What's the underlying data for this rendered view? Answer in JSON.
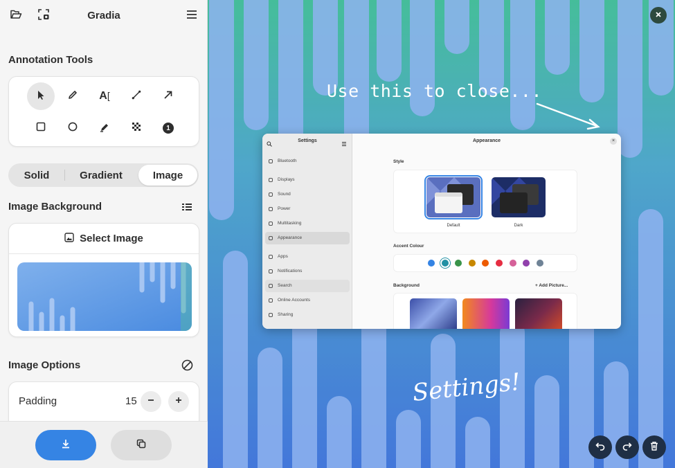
{
  "app": {
    "title": "Gradia"
  },
  "sidebar": {
    "annotation_tools_title": "Annotation Tools",
    "tools": [
      {
        "name": "select-icon"
      },
      {
        "name": "pencil-icon"
      },
      {
        "name": "text-icon"
      },
      {
        "name": "line-icon"
      },
      {
        "name": "arrow-icon"
      },
      {
        "name": "rectangle-icon"
      },
      {
        "name": "circle-icon"
      },
      {
        "name": "highlighter-icon"
      },
      {
        "name": "censor-icon"
      },
      {
        "name": "number-icon"
      }
    ],
    "number_tool_label": "1",
    "text_tool_label": "A",
    "background_modes": [
      "Solid",
      "Gradient",
      "Image"
    ],
    "active_background_mode": "Image",
    "image_background_title": "Image Background",
    "select_image_label": "Select Image",
    "image_options_title": "Image Options",
    "padding": {
      "label": "Padding",
      "value": "15"
    }
  },
  "canvas": {
    "overlay_text": "Use this to close...",
    "handwriting_text": "Settings!",
    "colors": {
      "gradient_top": "#3cbf8f",
      "gradient_bottom": "#3a6fd8",
      "blob": "#8fb3f0"
    }
  },
  "settings_window": {
    "sidebar_title": "Settings",
    "main_title": "Appearance",
    "sidebar_items": [
      "Bluetooth",
      "Displays",
      "Sound",
      "Power",
      "Multitasking",
      "Appearance",
      "Apps",
      "Notifications",
      "Search",
      "Online Accounts",
      "Sharing"
    ],
    "selected_item": "Appearance",
    "style_label": "Style",
    "style_options": [
      "Default",
      "Dark"
    ],
    "accent_label": "Accent Colour",
    "accent_colors": [
      "#3584e4",
      "#2190a4",
      "#3a944a",
      "#c88800",
      "#ed5b00",
      "#e62d42",
      "#d56199",
      "#9141ac",
      "#6f8396"
    ],
    "background_label": "Background",
    "add_picture_label": "+ Add Picture..."
  }
}
